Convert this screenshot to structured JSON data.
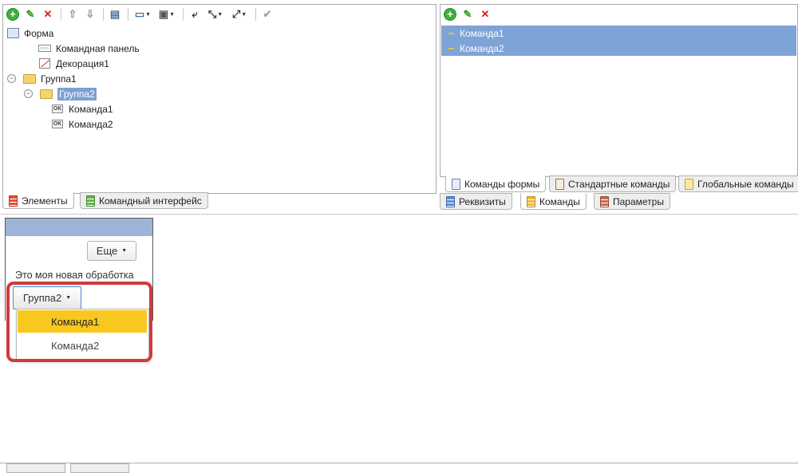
{
  "left_pane": {
    "toolbar": [
      {
        "icon": "add-circle-icon",
        "glyph": "+"
      },
      {
        "icon": "edit-pencil-icon",
        "glyph": "✎"
      },
      {
        "icon": "delete-x-icon",
        "glyph": "✕"
      },
      {
        "icon": "move-up-icon",
        "glyph": "⇧"
      },
      {
        "icon": "move-down-icon",
        "glyph": "⇩"
      },
      {
        "icon": "form-properties-icon",
        "glyph": "▤"
      },
      {
        "icon": "add-field-icon",
        "glyph": "▭"
      },
      {
        "icon": "add-group-icon",
        "glyph": "▣"
      },
      {
        "icon": "line-feed-icon",
        "glyph": "⤶"
      },
      {
        "icon": "resize-icon",
        "glyph": "⤡"
      },
      {
        "icon": "stretch-icon",
        "glyph": "⤢"
      },
      {
        "icon": "check-icon",
        "glyph": "✔"
      }
    ],
    "tree": {
      "form": "Форма",
      "command_panel": "Командная панель",
      "decoration": "Декорация1",
      "group1": "Группа1",
      "group2": "Группа2",
      "command1": "Команда1",
      "command2": "Команда2"
    },
    "tabs": {
      "elements": "Элементы",
      "command_interface": "Командный интерфейс"
    }
  },
  "right_pane": {
    "toolbar": [
      {
        "icon": "add-circle-icon",
        "glyph": "+"
      },
      {
        "icon": "edit-pencil-icon",
        "glyph": "✎"
      },
      {
        "icon": "delete-x-icon",
        "glyph": "✕"
      }
    ],
    "commands": [
      "Команда1",
      "Команда2"
    ],
    "subtabs": {
      "form_commands": "Команды формы",
      "standard_commands": "Стандартные команды",
      "global_commands": "Глобальные команды"
    },
    "tabs": {
      "attributes": "Реквизиты",
      "commands": "Команды",
      "parameters": "Параметры"
    }
  },
  "preview": {
    "more_button": "Еще",
    "text": "Это моя новая обработка",
    "group_button": "Группа2",
    "dropdown": [
      "Команда1",
      "Команда2"
    ]
  },
  "colors": {
    "selection": "#7ea3d6",
    "highlight": "#f8c81f",
    "callout": "#cf3b3b"
  }
}
